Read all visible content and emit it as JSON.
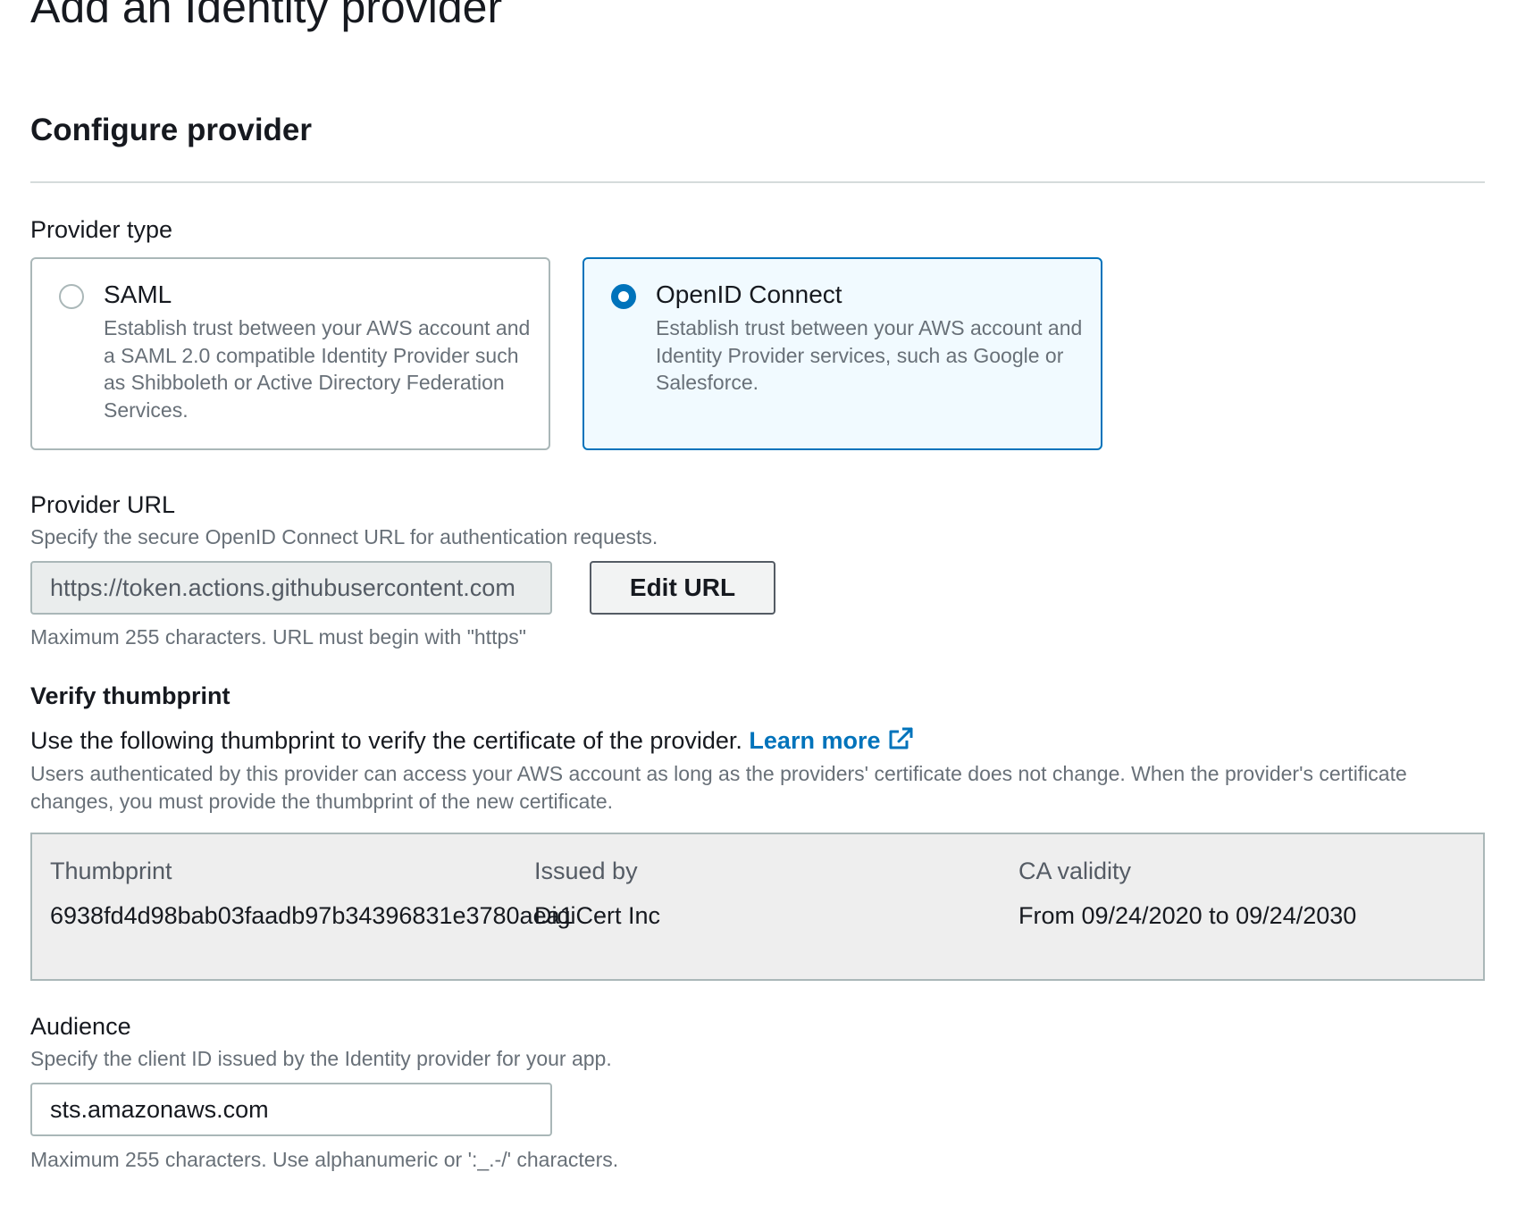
{
  "page": {
    "title": "Add an Identity provider",
    "section_title": "Configure provider"
  },
  "provider_type": {
    "label": "Provider type",
    "options": [
      {
        "title": "SAML",
        "description": "Establish trust between your AWS account and a SAML 2.0 compatible Identity Provider such as Shibboleth or Active Directory Federation Services.",
        "selected": false
      },
      {
        "title": "OpenID Connect",
        "description": "Establish trust between your AWS account and Identity Provider services, such as Google or Salesforce.",
        "selected": true
      }
    ]
  },
  "provider_url": {
    "label": "Provider URL",
    "description": "Specify the secure OpenID Connect URL for authentication requests.",
    "value": "https://token.actions.githubusercontent.com",
    "edit_button": "Edit URL",
    "constraint": "Maximum 255 characters. URL must begin with \"https\""
  },
  "thumbprint": {
    "heading": "Verify thumbprint",
    "lead": "Use the following thumbprint to verify the certificate of the provider.",
    "learn_more": "Learn more",
    "description": "Users authenticated by this provider can access your AWS account as long as the providers' certificate does not change. When the provider's certificate changes, you must provide the thumbprint of the new certificate.",
    "columns": {
      "thumbprint": "Thumbprint",
      "issued_by": "Issued by",
      "ca_validity": "CA validity"
    },
    "values": {
      "thumbprint": "6938fd4d98bab03faadb97b34396831e3780aea1",
      "issued_by": "DigiCert Inc",
      "ca_validity": "From 09/24/2020 to 09/24/2030"
    }
  },
  "audience": {
    "label": "Audience",
    "description": "Specify the client ID issued by the Identity provider for your app.",
    "value": "sts.amazonaws.com",
    "constraint": "Maximum 255 characters. Use alphanumeric or ':_.-/' characters."
  },
  "colors": {
    "accent": "#0073bb",
    "selected_tile_bg": "#f1faff",
    "muted_text": "#687078",
    "border": "#aab7b8"
  },
  "icons": {
    "external_link": "external-link-icon"
  }
}
